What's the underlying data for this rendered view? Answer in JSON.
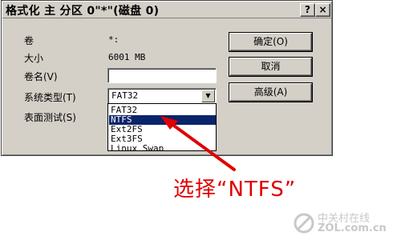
{
  "dialog": {
    "title": "格式化 主 分区 0\"*\"(磁盘 0)",
    "help_label": "?",
    "close_label": "×"
  },
  "fields": {
    "volume_label": "卷",
    "volume_value": "*:",
    "size_label": "大小",
    "size_value": "6001 MB",
    "volume_name_label": "卷名(V)",
    "volume_name_value": "",
    "fs_type_label": "系统类型(T)",
    "surface_test_label": "表面测试(S)"
  },
  "fs_select": {
    "selected": "FAT32",
    "options": [
      "FAT32",
      "NTFS",
      "Ext2FS",
      "Ext3FS",
      "Linux Swap"
    ],
    "highlighted": "NTFS"
  },
  "buttons": {
    "ok_label": "确定(O)",
    "cancel_label": "取消",
    "advanced_label": "高级(A)"
  },
  "annotation": {
    "text": "选择“NTFS”",
    "color": "#e00000"
  },
  "watermark": {
    "line1": "中关村在线",
    "line2": "ZOL.com.cn"
  }
}
